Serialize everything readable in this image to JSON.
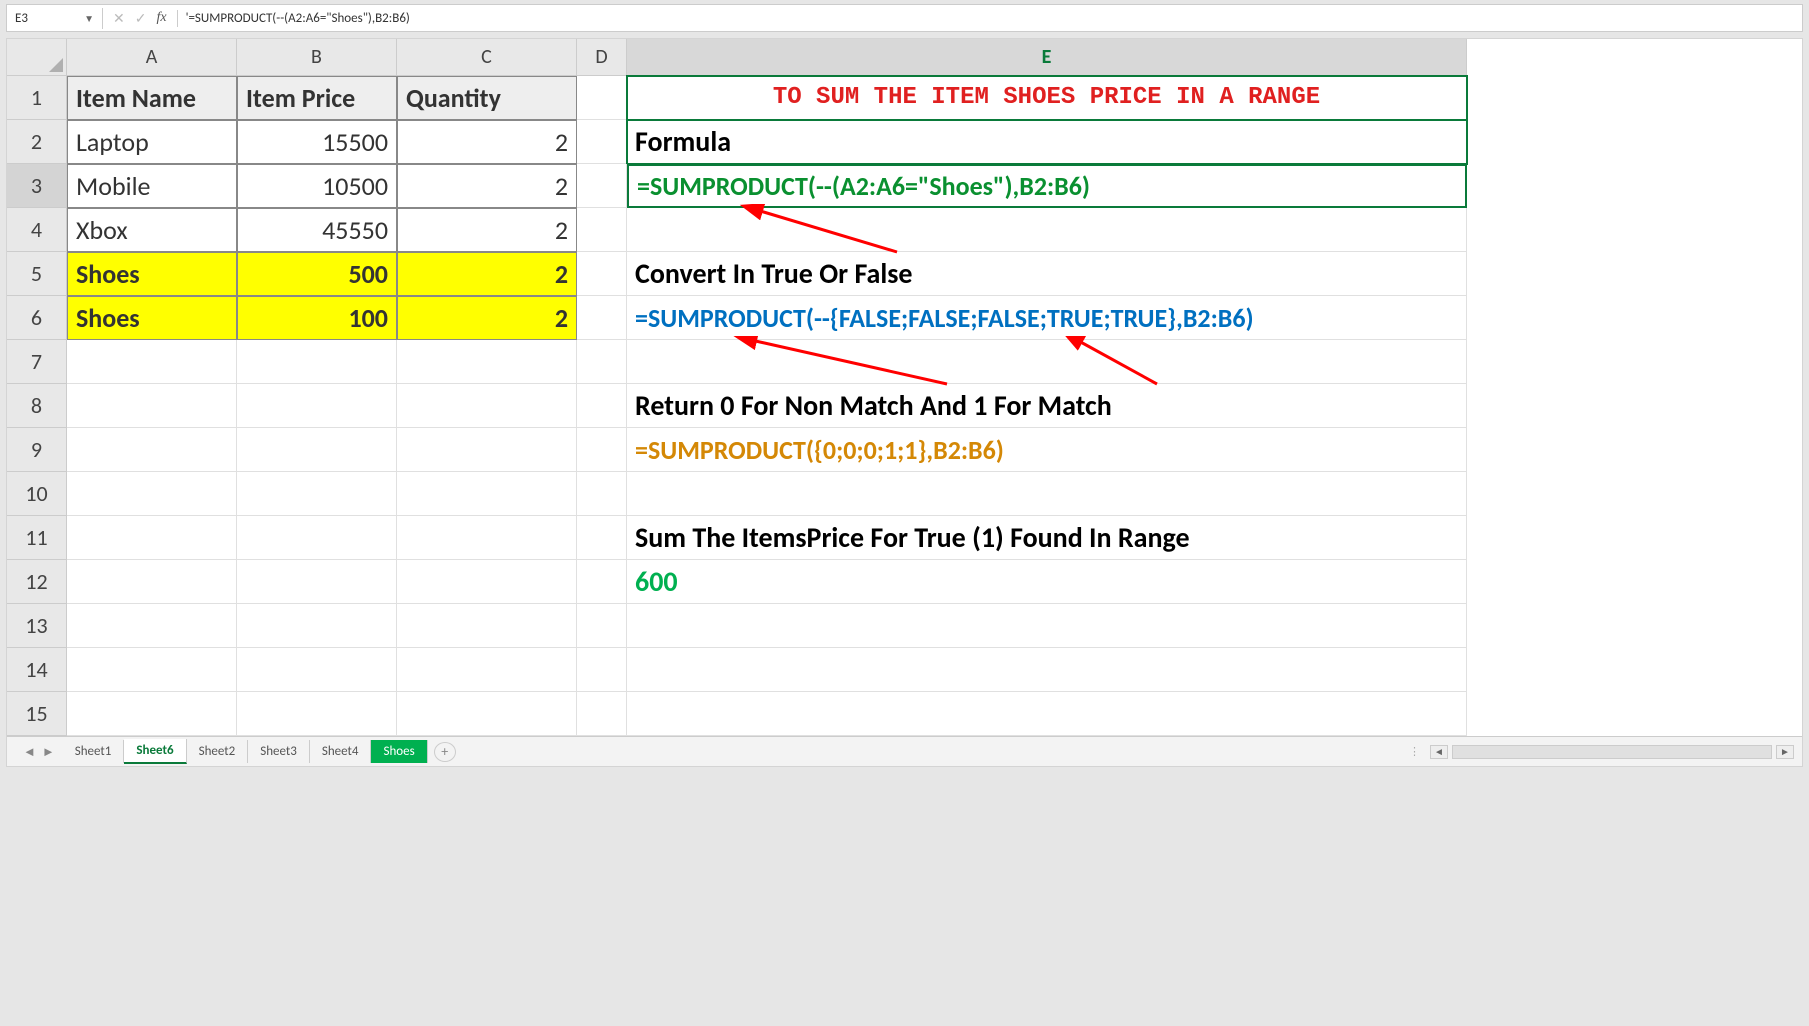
{
  "namebox": "E3",
  "formula_bar": "'=SUMPRODUCT(--(A2:A6=\"Shoes\"),B2:B6)",
  "col_headers": [
    "A",
    "B",
    "C",
    "D",
    "E"
  ],
  "row_headers": [
    "1",
    "2",
    "3",
    "4",
    "5",
    "6",
    "7",
    "8",
    "9",
    "10",
    "11",
    "12",
    "13",
    "14",
    "15"
  ],
  "table": {
    "h_item": "Item Name",
    "h_price": "Item Price",
    "h_qty": "Quantity",
    "rows": [
      {
        "name": "Laptop",
        "price": "15500",
        "qty": "2"
      },
      {
        "name": "Mobile",
        "price": "10500",
        "qty": "2"
      },
      {
        "name": "Xbox",
        "price": "45550",
        "qty": "2"
      },
      {
        "name": "Shoes",
        "price": "500",
        "qty": "2"
      },
      {
        "name": "Shoes",
        "price": "100",
        "qty": "2"
      }
    ]
  },
  "E": {
    "title": "TO SUM THE ITEM SHOES PRICE IN A RANGE",
    "l_formula": "Formula",
    "f_green": "=SUMPRODUCT(--(A2:A6=\"Shoes\"),B2:B6)",
    "l_convert": "Convert In True Or False",
    "f_blue": "=SUMPRODUCT(--{FALSE;FALSE;FALSE;TRUE;TRUE},B2:B6)",
    "l_return": "Return 0 For Non Match And 1 For Match",
    "f_orange": "=SUMPRODUCT({0;0;0;1;1},B2:B6)",
    "l_sum": "Sum The ItemsPrice For True (1) Found In Range",
    "result": "600"
  },
  "tabs": {
    "t1": "Sheet1",
    "t2": "Sheet6",
    "t3": "Sheet2",
    "t4": "Sheet3",
    "t5": "Sheet4",
    "t6": "Shoes"
  }
}
